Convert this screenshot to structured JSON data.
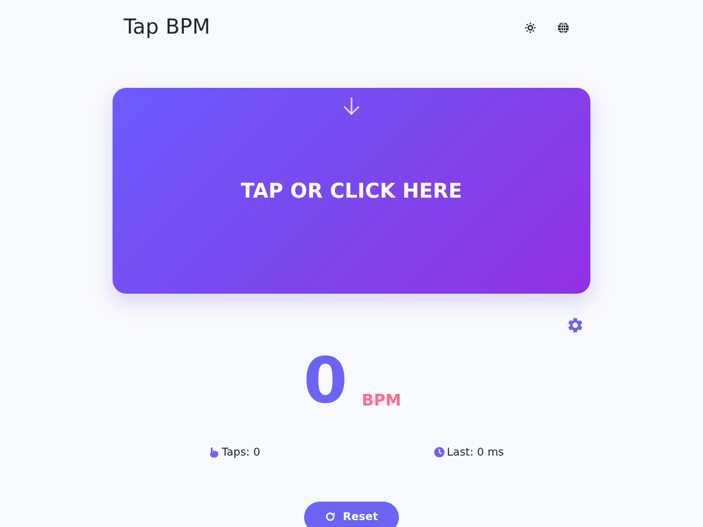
{
  "header": {
    "title": "Tap BPM",
    "theme_icon": "sun-icon",
    "language_icon": "globe-icon"
  },
  "tap_area": {
    "label": "TAP OR CLICK HERE",
    "arrow_icon": "arrow-down-icon",
    "gradient_start": "#6c5cfe",
    "gradient_end": "#9230e4"
  },
  "settings": {
    "icon": "gear-icon"
  },
  "bpm": {
    "value": "0",
    "unit": "BPM"
  },
  "stats": {
    "taps": "Taps: 0",
    "taps_icon": "hand-pointer-icon",
    "last": "Last: 0 ms",
    "last_icon": "clock-icon"
  },
  "reset": {
    "label": "Reset",
    "icon": "redo-icon"
  },
  "colors": {
    "accent": "#6c63f5",
    "unit": "#ff6b8a",
    "background": "#f8f9fc",
    "text": "#1f2230"
  }
}
